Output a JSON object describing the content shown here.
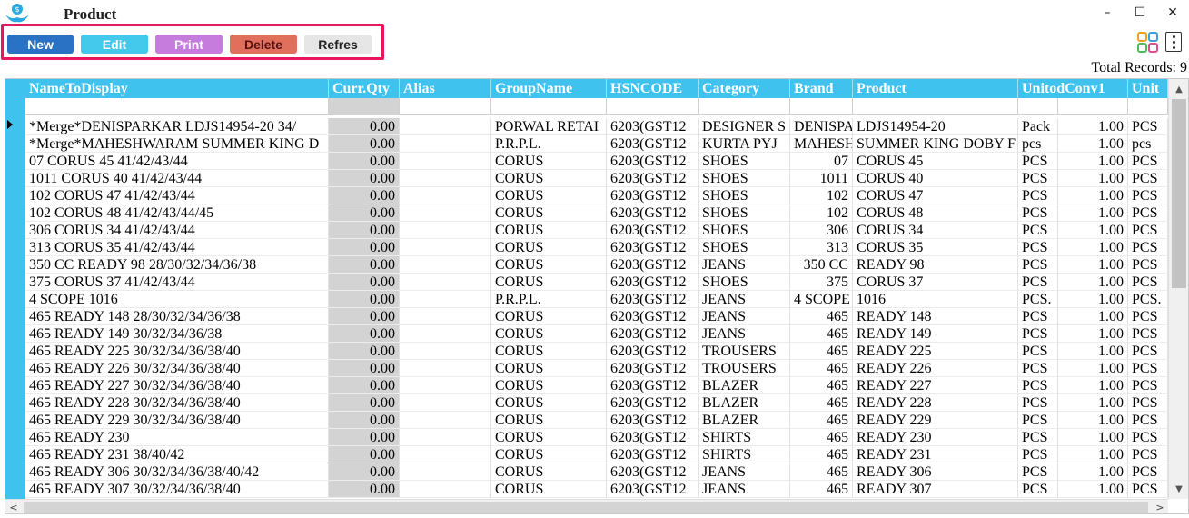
{
  "window": {
    "title": "Product",
    "minimize": "–",
    "maximize": "☐",
    "close": "✕"
  },
  "toolbar": {
    "new_label": "New",
    "edit_label": "Edit",
    "print_label": "Print",
    "delete_label": "Delete",
    "refresh_label": "Refres"
  },
  "total_records": "Total Records: 9",
  "grid": {
    "columns": [
      "NameToDisplay",
      "Curr.Qty",
      "Alias",
      "GroupName",
      "HSNCODE",
      "Category",
      "Brand",
      "Product",
      "UnitodConv1",
      "Unit"
    ],
    "rows": [
      [
        "*Merge*DENISPARKAR LDJS14954-20 34/",
        "0.00",
        "",
        "PORWAL RETAI",
        "6203(GST12",
        "DESIGNER S",
        "DENISPA",
        "LDJS14954-20",
        "Pack",
        "1.00",
        "PCS"
      ],
      [
        "*Merge*MAHESHWARAM SUMMER KING D",
        "0.00",
        "",
        "P.R.P.L.",
        "6203(GST12",
        "KURTA PYJ",
        "MAHESH",
        "SUMMER KING DOBY F",
        "pcs",
        "1.00",
        "pcs"
      ],
      [
        "07 CORUS 45 41/42/43/44",
        "0.00",
        "",
        "CORUS",
        "6203(GST12",
        "SHOES",
        "07",
        "CORUS 45",
        "PCS",
        "1.00",
        "PCS"
      ],
      [
        "1011 CORUS 40 41/42/43/44",
        "0.00",
        "",
        "CORUS",
        "6203(GST12",
        "SHOES",
        "1011",
        "CORUS 40",
        "PCS",
        "1.00",
        "PCS"
      ],
      [
        "102 CORUS 47 41/42/43/44",
        "0.00",
        "",
        "CORUS",
        "6203(GST12",
        "SHOES",
        "102",
        "CORUS 47",
        "PCS",
        "1.00",
        "PCS"
      ],
      [
        "102 CORUS 48 41/42/43/44/45",
        "0.00",
        "",
        "CORUS",
        "6203(GST12",
        "SHOES",
        "102",
        "CORUS 48",
        "PCS",
        "1.00",
        "PCS"
      ],
      [
        "306 CORUS 34 41/42/43/44",
        "0.00",
        "",
        "CORUS",
        "6203(GST12",
        "SHOES",
        "306",
        "CORUS 34",
        "PCS",
        "1.00",
        "PCS"
      ],
      [
        "313 CORUS 35 41/42/43/44",
        "0.00",
        "",
        "CORUS",
        "6203(GST12",
        "SHOES",
        "313",
        "CORUS 35",
        "PCS",
        "1.00",
        "PCS"
      ],
      [
        "350 CC READY 98 28/30/32/34/36/38",
        "0.00",
        "",
        "CORUS",
        "6203(GST12",
        "JEANS",
        "350 CC",
        "READY 98",
        "PCS",
        "1.00",
        "PCS"
      ],
      [
        "375 CORUS 37 41/42/43/44",
        "0.00",
        "",
        "CORUS",
        "6203(GST12",
        "SHOES",
        "375",
        "CORUS 37",
        "PCS",
        "1.00",
        "PCS"
      ],
      [
        "4 SCOPE 1016",
        "0.00",
        "",
        "P.R.P.L.",
        "6203(GST12",
        "JEANS",
        "4 SCOPE",
        "1016",
        "PCS.",
        "1.00",
        "PCS."
      ],
      [
        "465 READY 148 28/30/32/34/36/38",
        "0.00",
        "",
        "CORUS",
        "6203(GST12",
        "JEANS",
        "465",
        "READY 148",
        "PCS",
        "1.00",
        "PCS"
      ],
      [
        "465 READY 149 30/32/34/36/38",
        "0.00",
        "",
        "CORUS",
        "6203(GST12",
        "JEANS",
        "465",
        "READY 149",
        "PCS",
        "1.00",
        "PCS"
      ],
      [
        "465 READY 225 30/32/34/36/38/40",
        "0.00",
        "",
        "CORUS",
        "6203(GST12",
        "TROUSERS",
        "465",
        "READY 225",
        "PCS",
        "1.00",
        "PCS"
      ],
      [
        "465 READY 226 30/32/34/36/38/40",
        "0.00",
        "",
        "CORUS",
        "6203(GST12",
        "TROUSERS",
        "465",
        "READY 226",
        "PCS",
        "1.00",
        "PCS"
      ],
      [
        "465 READY 227 30/32/34/36/38/40",
        "0.00",
        "",
        "CORUS",
        "6203(GST12",
        "BLAZER",
        "465",
        "READY 227",
        "PCS",
        "1.00",
        "PCS"
      ],
      [
        "465 READY 228 30/32/34/36/38/40",
        "0.00",
        "",
        "CORUS",
        "6203(GST12",
        "BLAZER",
        "465",
        "READY 228",
        "PCS",
        "1.00",
        "PCS"
      ],
      [
        "465 READY 229 30/32/34/36/38/40",
        "0.00",
        "",
        "CORUS",
        "6203(GST12",
        "BLAZER",
        "465",
        "READY 229",
        "PCS",
        "1.00",
        "PCS"
      ],
      [
        "465 READY 230",
        "0.00",
        "",
        "CORUS",
        "6203(GST12",
        "SHIRTS",
        "465",
        "READY 230",
        "PCS",
        "1.00",
        "PCS"
      ],
      [
        "465 READY 231 38/40/42",
        "0.00",
        "",
        "CORUS",
        "6203(GST12",
        "SHIRTS",
        "465",
        "READY 231",
        "PCS",
        "1.00",
        "PCS"
      ],
      [
        "465 READY 306 30/32/34/36/38/40/42",
        "0.00",
        "",
        "CORUS",
        "6203(GST12",
        "JEANS",
        "465",
        "READY 306",
        "PCS",
        "1.00",
        "PCS"
      ],
      [
        "465 READY 307 30/32/34/36/38/40",
        "0.00",
        "",
        "CORUS",
        "6203(GST12",
        "JEANS",
        "465",
        "READY 307",
        "PCS",
        "1.00",
        "PCS"
      ]
    ]
  }
}
